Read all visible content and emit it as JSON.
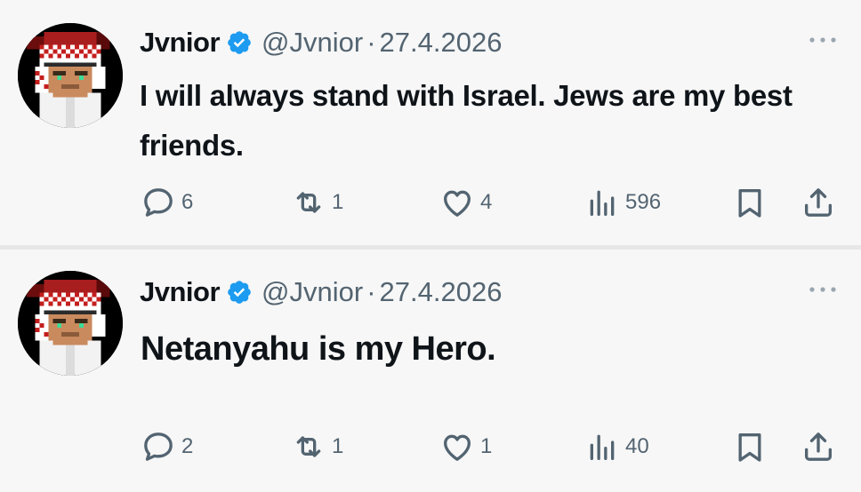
{
  "tweets": [
    {
      "display_name": "Jvnior",
      "handle": "@Jvnior",
      "separator": "·",
      "date": "27.4.2026",
      "text": "I will always stand with Israel. Jews are my best friends.",
      "replies": "6",
      "reposts": "1",
      "likes": "4",
      "views": "596"
    },
    {
      "display_name": "Jvnior",
      "handle": "@Jvnior",
      "separator": "·",
      "date": "27.4.2026",
      "text": "Netanyahu is my Hero.",
      "replies": "2",
      "reposts": "1",
      "likes": "1",
      "views": "40"
    }
  ],
  "icons": {
    "verified": "verified-badge-icon",
    "more": "more-options-icon",
    "reply": "reply-icon",
    "repost": "repost-icon",
    "like": "heart-icon",
    "views": "views-icon",
    "bookmark": "bookmark-icon",
    "share": "share-icon"
  },
  "colors": {
    "verified_blue": "#1d9bf0",
    "text": "#0f1419",
    "muted": "#536471",
    "background": "#f7f7f7"
  }
}
